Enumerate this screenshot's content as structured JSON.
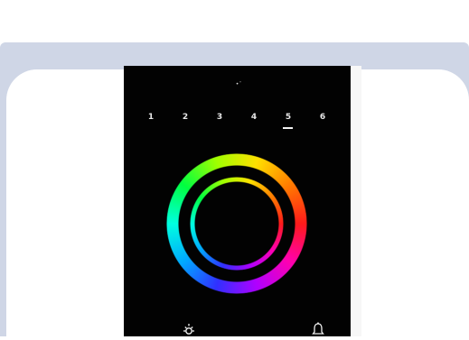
{
  "device": {
    "indicator_glyph": "•̈",
    "zones": [
      {
        "label": "1"
      },
      {
        "label": "2"
      },
      {
        "label": "3"
      },
      {
        "label": "4"
      },
      {
        "label": "5",
        "selected": true
      },
      {
        "label": "6"
      }
    ],
    "color_wheel": {
      "outer_ring": "hue-ring",
      "inner_ring": "hue-ring"
    },
    "bottom_icons": [
      "brightness-icon",
      "bell-icon"
    ]
  },
  "colors": {
    "frame": "#cfd6e6",
    "card": "#ffffff",
    "panel": "#020202",
    "text": "#e8e8e8"
  }
}
